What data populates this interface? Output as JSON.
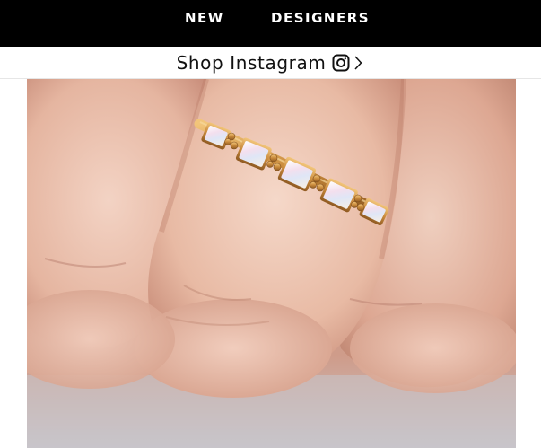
{
  "nav": {
    "items": [
      {
        "label": "NEW"
      },
      {
        "label": "DESIGNERS"
      }
    ]
  },
  "instagram": {
    "label": "Shop Instagram",
    "icon": "instagram-icon",
    "chevron": "chevron-right-icon"
  },
  "hero": {
    "subject": "hand-with-opal-ring-image"
  },
  "colors": {
    "nav_bg": "#000000",
    "nav_text": "#ffffff",
    "ring_gold": "#c98a3c",
    "opal": "#f3eef3"
  }
}
